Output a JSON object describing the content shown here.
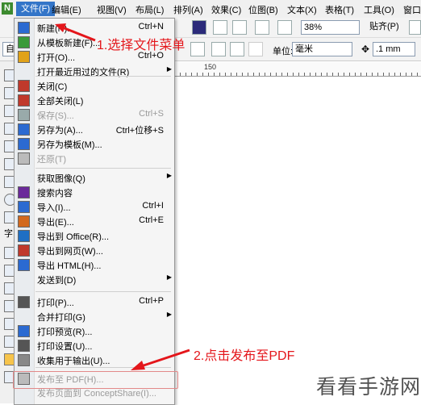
{
  "app_icon": "N",
  "menubar": {
    "items": [
      "文件(F)",
      "编辑(E)",
      "视图(V)",
      "布局(L)",
      "排列(A)",
      "效果(C)",
      "位图(B)",
      "文本(X)",
      "表格(T)",
      "工具(O)",
      "窗口"
    ]
  },
  "toolbar": {
    "zoom": "38%",
    "snap": "贴齐(P)",
    "unit_label": "单位:",
    "unit_value": "毫米",
    "nudge": ".1 mm",
    "left_combo": "自"
  },
  "ruler": {
    "label": "150"
  },
  "file_menu": {
    "items": [
      {
        "label": "新建(N)...",
        "shortcut": "Ctrl+N",
        "icon": "new-doc-icon"
      },
      {
        "label": "从模板新建(F)...",
        "shortcut": "",
        "icon": "template-icon"
      },
      {
        "label": "打开(O)...",
        "shortcut": "Ctrl+O",
        "icon": "open-folder-icon"
      },
      {
        "label": "打开最近用过的文件(R)",
        "shortcut": "",
        "icon": "",
        "submenu": true
      },
      {
        "label": "关闭(C)",
        "shortcut": "",
        "icon": "close-doc-icon"
      },
      {
        "label": "全部关闭(L)",
        "shortcut": "",
        "icon": "close-all-icon"
      },
      {
        "label": "保存(S)...",
        "shortcut": "Ctrl+S",
        "icon": "save-icon",
        "disabled": true
      },
      {
        "label": "另存为(A)...",
        "shortcut": "Ctrl+位移+S",
        "icon": "save-as-icon"
      },
      {
        "label": "另存为模板(M)...",
        "shortcut": "",
        "icon": "save-template-icon"
      },
      {
        "label": "还原(T)",
        "shortcut": "",
        "icon": "revert-icon",
        "disabled": true
      },
      {
        "label": "获取图像(Q)",
        "shortcut": "",
        "icon": "",
        "submenu": true
      },
      {
        "label": "搜索内容",
        "shortcut": "",
        "icon": "search-content-icon"
      },
      {
        "label": "导入(I)...",
        "shortcut": "Ctrl+I",
        "icon": "import-icon"
      },
      {
        "label": "导出(E)...",
        "shortcut": "Ctrl+E",
        "icon": "export-icon"
      },
      {
        "label": "导出到 Office(R)...",
        "shortcut": "",
        "icon": "office-icon"
      },
      {
        "label": "导出到网页(W)...",
        "shortcut": "",
        "icon": "web-export-icon"
      },
      {
        "label": "导出 HTML(H)...",
        "shortcut": "",
        "icon": "html-icon"
      },
      {
        "label": "发送到(D)",
        "shortcut": "",
        "icon": "",
        "submenu": true
      },
      {
        "label": "打印(P)...",
        "shortcut": "Ctrl+P",
        "icon": "print-icon"
      },
      {
        "label": "合并打印(G)",
        "shortcut": "",
        "icon": "",
        "submenu": true
      },
      {
        "label": "打印预览(R)...",
        "shortcut": "",
        "icon": "print-preview-icon"
      },
      {
        "label": "打印设置(U)...",
        "shortcut": "",
        "icon": "print-setup-icon"
      },
      {
        "label": "收集用于输出(U)...",
        "shortcut": "",
        "icon": "collect-output-icon"
      },
      {
        "label": "发布至 PDF(H)...",
        "shortcut": "",
        "icon": "pdf-icon",
        "disabled": true
      },
      {
        "label": "发布页面到 ConceptShare(I)...",
        "shortcut": "",
        "icon": "",
        "disabled": true
      }
    ]
  },
  "annotations": {
    "step1": "1.选择文件菜单",
    "step2": "2.点击发布至PDF"
  },
  "watermark": "看看手游网"
}
